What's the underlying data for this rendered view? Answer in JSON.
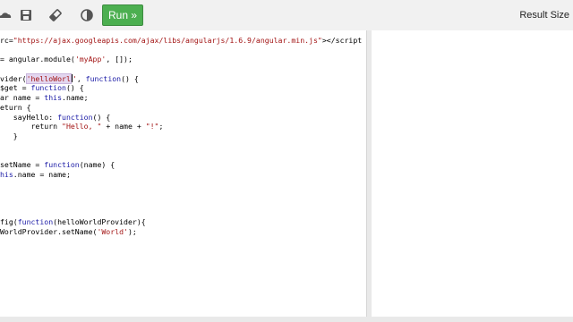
{
  "toolbar": {
    "run_label": "Run »",
    "icons": [
      "cloud-icon",
      "save-icon",
      "eraser-icon",
      "contrast-icon"
    ]
  },
  "result_panel": {
    "title": "Result Size"
  },
  "code_lines": [
    [
      {
        "t": "rc=",
        "c": ""
      },
      {
        "t": "\"https://ajax.googleapis.com/ajax/libs/angularjs/1.6.9/angular.min.js\"",
        "c": "str"
      },
      {
        "t": "></script",
        "c": ""
      }
    ],
    [],
    [
      {
        "t": "= angular.module(",
        "c": ""
      },
      {
        "t": "'myApp'",
        "c": "str"
      },
      {
        "t": ", []);",
        "c": ""
      }
    ],
    [],
    [
      {
        "t": "vider(",
        "c": ""
      },
      {
        "t": "'helloWorl",
        "c": "str hl"
      },
      {
        "t": "|",
        "c": "cursor"
      },
      {
        "t": "'",
        "c": "str"
      },
      {
        "t": ", ",
        "c": ""
      },
      {
        "t": "function",
        "c": "kw"
      },
      {
        "t": "() {",
        "c": ""
      }
    ],
    [
      {
        "t": "$get = ",
        "c": ""
      },
      {
        "t": "function",
        "c": "kw"
      },
      {
        "t": "() {",
        "c": ""
      }
    ],
    [
      {
        "t": "ar name = ",
        "c": ""
      },
      {
        "t": "this",
        "c": "kw"
      },
      {
        "t": ".name;",
        "c": ""
      }
    ],
    [
      {
        "t": "eturn {",
        "c": ""
      }
    ],
    [
      {
        "t": "   sayHello: ",
        "c": ""
      },
      {
        "t": "function",
        "c": "kw"
      },
      {
        "t": "() {",
        "c": ""
      }
    ],
    [
      {
        "t": "       return ",
        "c": ""
      },
      {
        "t": "\"Hello, \"",
        "c": "str"
      },
      {
        "t": " + name + ",
        "c": ""
      },
      {
        "t": "\"!\"",
        "c": "str"
      },
      {
        "t": ";",
        "c": ""
      }
    ],
    [
      {
        "t": "   }",
        "c": ""
      }
    ],
    [],
    [],
    [
      {
        "t": "setName = ",
        "c": ""
      },
      {
        "t": "function",
        "c": "kw"
      },
      {
        "t": "(name) {",
        "c": ""
      }
    ],
    [
      {
        "t": "his",
        "c": "kw"
      },
      {
        "t": ".name = name;",
        "c": ""
      }
    ],
    [],
    [],
    [],
    [],
    [
      {
        "t": "fig(",
        "c": ""
      },
      {
        "t": "function",
        "c": "kw"
      },
      {
        "t": "(helloWorldProvider){",
        "c": ""
      }
    ],
    [
      {
        "t": "WorldProvider.setName(",
        "c": ""
      },
      {
        "t": "'World'",
        "c": "str"
      },
      {
        "t": ");",
        "c": ""
      }
    ]
  ]
}
